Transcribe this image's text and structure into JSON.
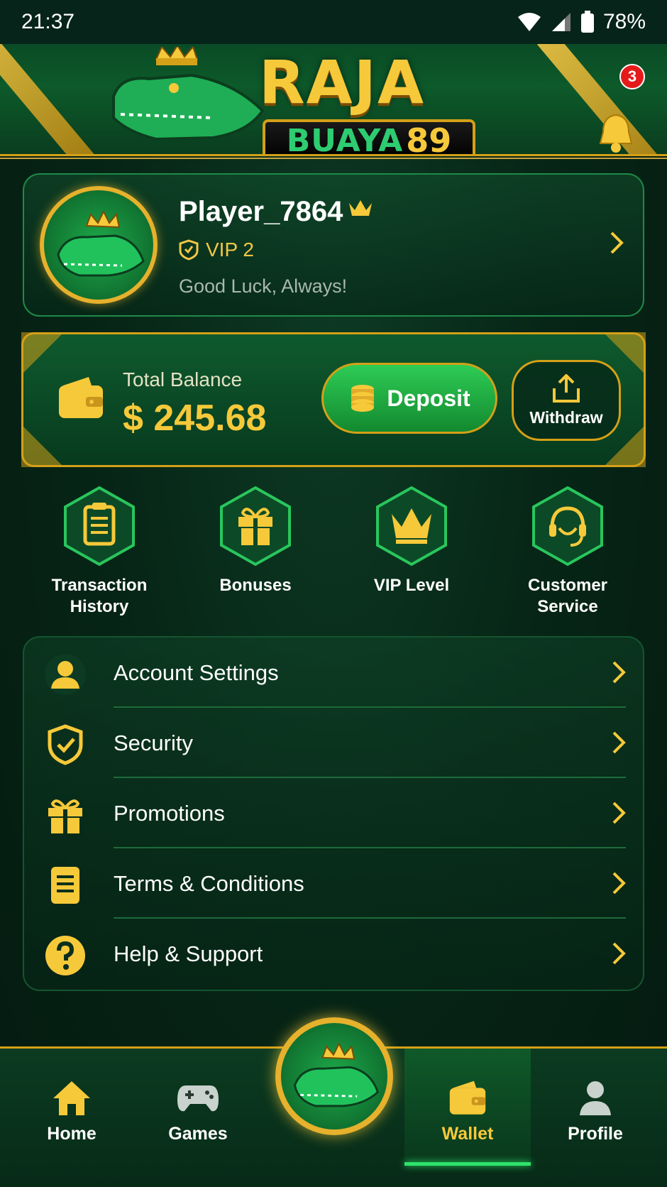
{
  "status_bar": {
    "time": "21:37",
    "battery": "78%"
  },
  "header": {
    "logo_top": "RAJA",
    "logo_bottom": "BUAYA",
    "logo_number": "89",
    "notification_count": "3"
  },
  "profile": {
    "name": "Player_7864",
    "vip": "VIP 2",
    "tagline": "Good Luck, Always!"
  },
  "balance": {
    "label": "Total Balance",
    "value": "$ 245.68",
    "deposit_label": "Deposit",
    "withdraw_label": "Withdraw"
  },
  "quick_actions": [
    {
      "label": "Transaction History",
      "icon": "clipboard-icon"
    },
    {
      "label": "Bonuses",
      "icon": "gift-icon"
    },
    {
      "label": "VIP Level",
      "icon": "crown-icon"
    },
    {
      "label": "Customer Service",
      "icon": "headset-icon"
    }
  ],
  "menu": [
    {
      "label": "Account Settings",
      "icon": "user-icon"
    },
    {
      "label": "Security",
      "icon": "shield-check-icon"
    },
    {
      "label": "Promotions",
      "icon": "gift-icon"
    },
    {
      "label": "Terms & Conditions",
      "icon": "document-icon"
    },
    {
      "label": "Help & Support",
      "icon": "question-icon"
    }
  ],
  "nav": [
    {
      "label": "Home",
      "icon": "home-icon"
    },
    {
      "label": "Games",
      "icon": "gamepad-icon"
    },
    {
      "label": "Wallet",
      "icon": "wallet-icon",
      "active": true
    },
    {
      "label": "Profile",
      "icon": "profile-icon"
    }
  ],
  "colors": {
    "gold": "#f6c93a",
    "green_dark": "#072617",
    "green_accent": "#2ecc55",
    "badge_red": "#e51b1b"
  }
}
